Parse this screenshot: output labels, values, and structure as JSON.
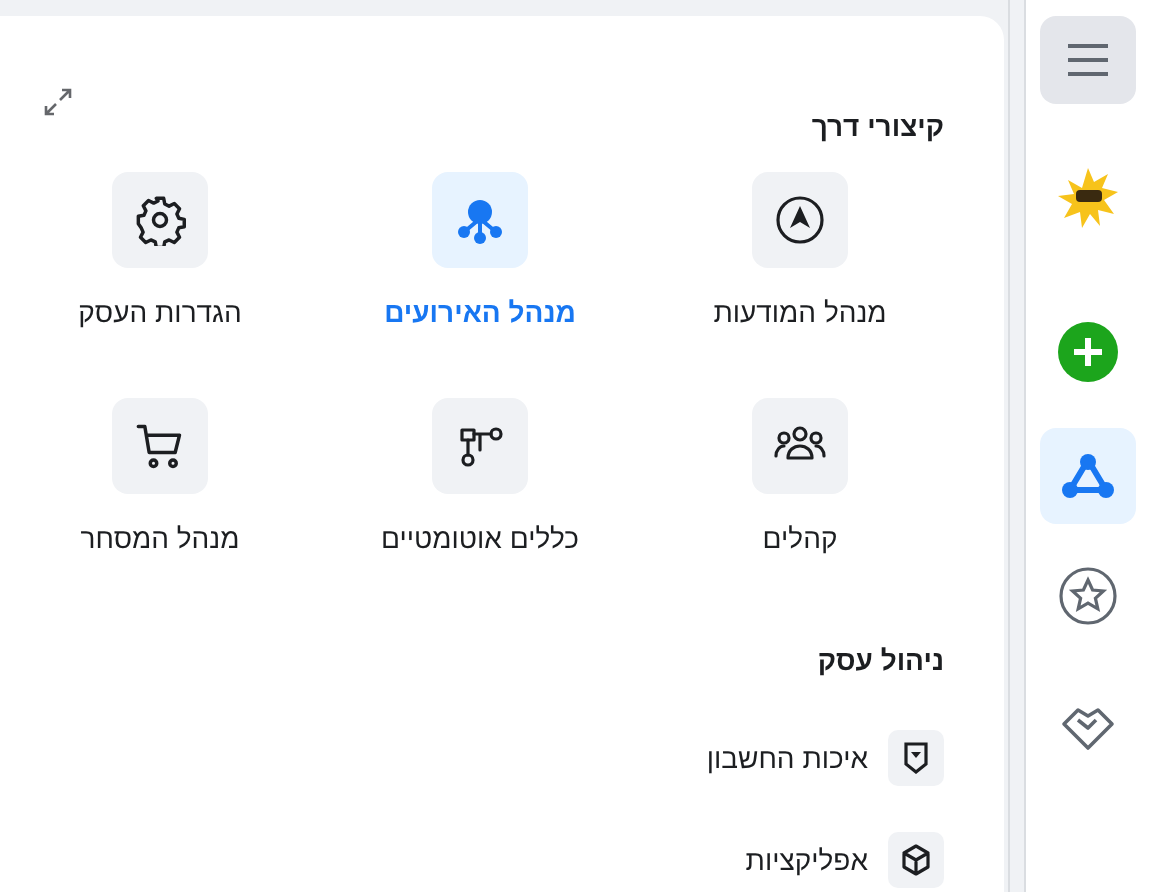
{
  "shortcuts": {
    "title": "קיצורי דרך",
    "items": [
      {
        "kind": "ads",
        "label": "מנהל המודעות",
        "selected": false
      },
      {
        "kind": "events",
        "label": "מנהל האירועים",
        "selected": true
      },
      {
        "kind": "settings",
        "label": "הגדרות העסק",
        "selected": false
      },
      {
        "kind": "audiences",
        "label": "קהלים",
        "selected": false
      },
      {
        "kind": "rules",
        "label": "כללים אוטומטיים",
        "selected": false
      },
      {
        "kind": "commerce",
        "label": "מנהל המסחר",
        "selected": false
      }
    ]
  },
  "business": {
    "title": "ניהול עסק",
    "items": [
      {
        "kind": "quality",
        "label": "איכות החשבון"
      },
      {
        "kind": "apps",
        "label": "אפליקציות"
      }
    ]
  },
  "sidebar": {
    "items": [
      {
        "kind": "menu",
        "selected": false
      },
      {
        "kind": "logo",
        "selected": false
      },
      {
        "kind": "create",
        "selected": false
      },
      {
        "kind": "events",
        "selected": true
      },
      {
        "kind": "favorites",
        "selected": false
      },
      {
        "kind": "partners",
        "selected": false
      }
    ]
  }
}
